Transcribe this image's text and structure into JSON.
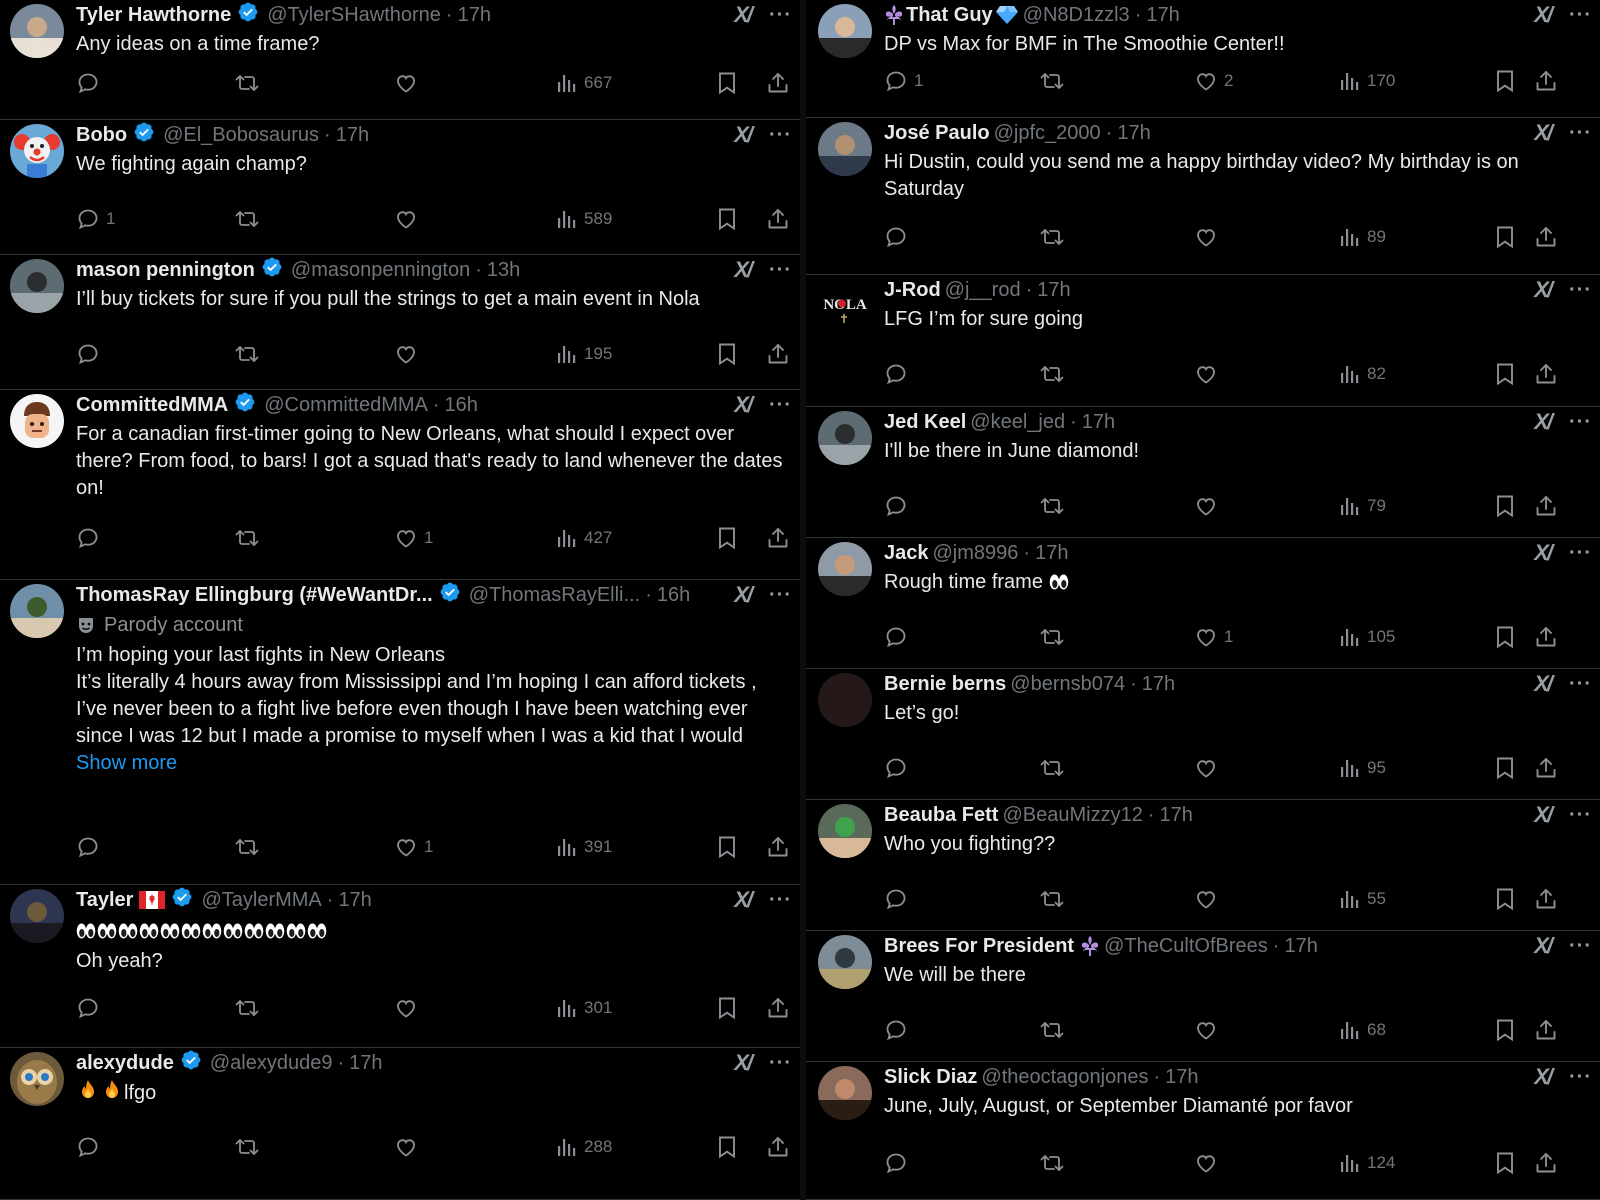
{
  "left": [
    {
      "name": "Tyler Hawthorne",
      "verified": true,
      "handle": "@TylerSHawthorne",
      "time": "17h",
      "text": "Any ideas on a time frame?",
      "replies": "",
      "likes": "",
      "views": "667",
      "avatar": "photo-people"
    },
    {
      "name": "Bobo",
      "verified": true,
      "handle": "@El_Bobosaurus",
      "time": "17h",
      "text": "We fighting again champ?",
      "replies": "1",
      "likes": "",
      "views": "589",
      "avatar": "clown"
    },
    {
      "name": "mason pennington",
      "verified": true,
      "handle": "@masonpennington",
      "time": "13h",
      "text": "I’ll buy tickets for sure if you pull the strings to get a main event in Nola",
      "replies": "",
      "likes": "",
      "views": "195",
      "avatar": "photo-group"
    },
    {
      "name": "CommittedMMA",
      "verified": true,
      "handle": "@CommittedMMA",
      "time": "16h",
      "text": "For a canadian first-timer going to New Orleans, what should I expect over there? From food, to bars! I got a squad that's ready to land whenever the dates on!",
      "replies": "",
      "likes": "1",
      "views": "427",
      "avatar": "cartoon-face"
    },
    {
      "name": "ThomasRay Ellingburg (#WeWantDr...",
      "verified": true,
      "handle": "@ThomasRayElli...",
      "time": "16h",
      "parody": "Parody account",
      "text": "I’m hoping your last fights in New Orleans\nIt’s literally 4 hours away from Mississippi and I’m hoping I can afford tickets , I’ve never been to a fight live before even though I have been watching ever since I was 12 but I made a promise to myself when I was a kid that I would",
      "show_more": "Show more",
      "replies": "",
      "likes": "1",
      "views": "391",
      "avatar": "photo-outdoor"
    },
    {
      "name": "Tayler",
      "flag": "canada-flag",
      "verified": true,
      "handle": "@TaylerMMA",
      "time": "17h",
      "eyes_emoji_count": 12,
      "text": "Oh yeah?",
      "replies": "",
      "likes": "",
      "views": "301",
      "avatar": "photo-dark"
    },
    {
      "name": "alexydude",
      "verified": true,
      "handle": "@alexydude9",
      "time": "17h",
      "fire_emoji_count": 2,
      "text": "lfgo",
      "replies": "",
      "likes": "",
      "views": "288",
      "avatar": "owl"
    }
  ],
  "right": [
    {
      "name": "That Guy",
      "prefix_icon": "fleur-de-lis",
      "suffix_icon": "diamond",
      "handle": "@N8D1zzl3",
      "time": "17h",
      "text": "DP vs Max for BMF in The Smoothie Center!!",
      "replies": "1",
      "likes": "2",
      "views": "170",
      "avatar": "photo-sunglasses"
    },
    {
      "name": "José Paulo",
      "handle": "@jpfc_2000",
      "time": "17h",
      "text": "Hi Dustin, could you send me a happy birthday video? My birthday is on Saturday",
      "replies": "",
      "likes": "",
      "views": "89",
      "avatar": "photo-person"
    },
    {
      "name": "J-Rod",
      "handle": "@j__rod",
      "time": "17h",
      "text": "LFG I’m for sure going",
      "replies": "",
      "likes": "",
      "views": "82",
      "avatar": "nola-logo",
      "avatar_text": "NOLA"
    },
    {
      "name": "Jed Keel",
      "handle": "@keel_jed",
      "time": "17h",
      "text": "I'll be there in June diamond!",
      "replies": "",
      "likes": "",
      "views": "79",
      "avatar": "photo-group"
    },
    {
      "name": "Jack",
      "handle": "@jm8996",
      "time": "17h",
      "text": "Rough time frame",
      "eyes_emoji_count": 1,
      "replies": "",
      "likes": "1",
      "views": "105",
      "avatar": "photo-cap"
    },
    {
      "name": "Bernie berns",
      "handle": "@bernsb074",
      "time": "17h",
      "text": "Let’s go!",
      "replies": "",
      "likes": "",
      "views": "95",
      "avatar": "dark-circle"
    },
    {
      "name": "Beauba Fett",
      "handle": "@BeauMizzy12",
      "time": "17h",
      "text": "Who you fighting??",
      "replies": "",
      "likes": "",
      "views": "55",
      "avatar": "photo-green"
    },
    {
      "name": "Brees For President",
      "suffix_icon": "fleur-de-lis",
      "handle": "@TheCultOfBrees",
      "time": "17h",
      "text": "We will be there",
      "replies": "",
      "likes": "",
      "views": "68",
      "avatar": "photo-car"
    },
    {
      "name": "Slick Diaz",
      "handle": "@theoctagonjones",
      "time": "17h",
      "text": "June, July, August, or September Diamanté por favor",
      "replies": "",
      "likes": "",
      "views": "124",
      "avatar": "photo-face"
    }
  ],
  "icons": {
    "reply": "reply-icon",
    "retweet": "retweet-icon",
    "like": "heart-icon",
    "views": "views-icon",
    "bookmark": "bookmark-icon",
    "share": "share-icon",
    "grok": "grok-icon",
    "more": "more-icon",
    "verified": "verified-badge"
  },
  "colors": {
    "background": "#000000",
    "text": "#e7e9ea",
    "muted": "#71767b",
    "link": "#1d9bf0",
    "verified": "#1d9bf0",
    "divider": "#2f3336"
  }
}
